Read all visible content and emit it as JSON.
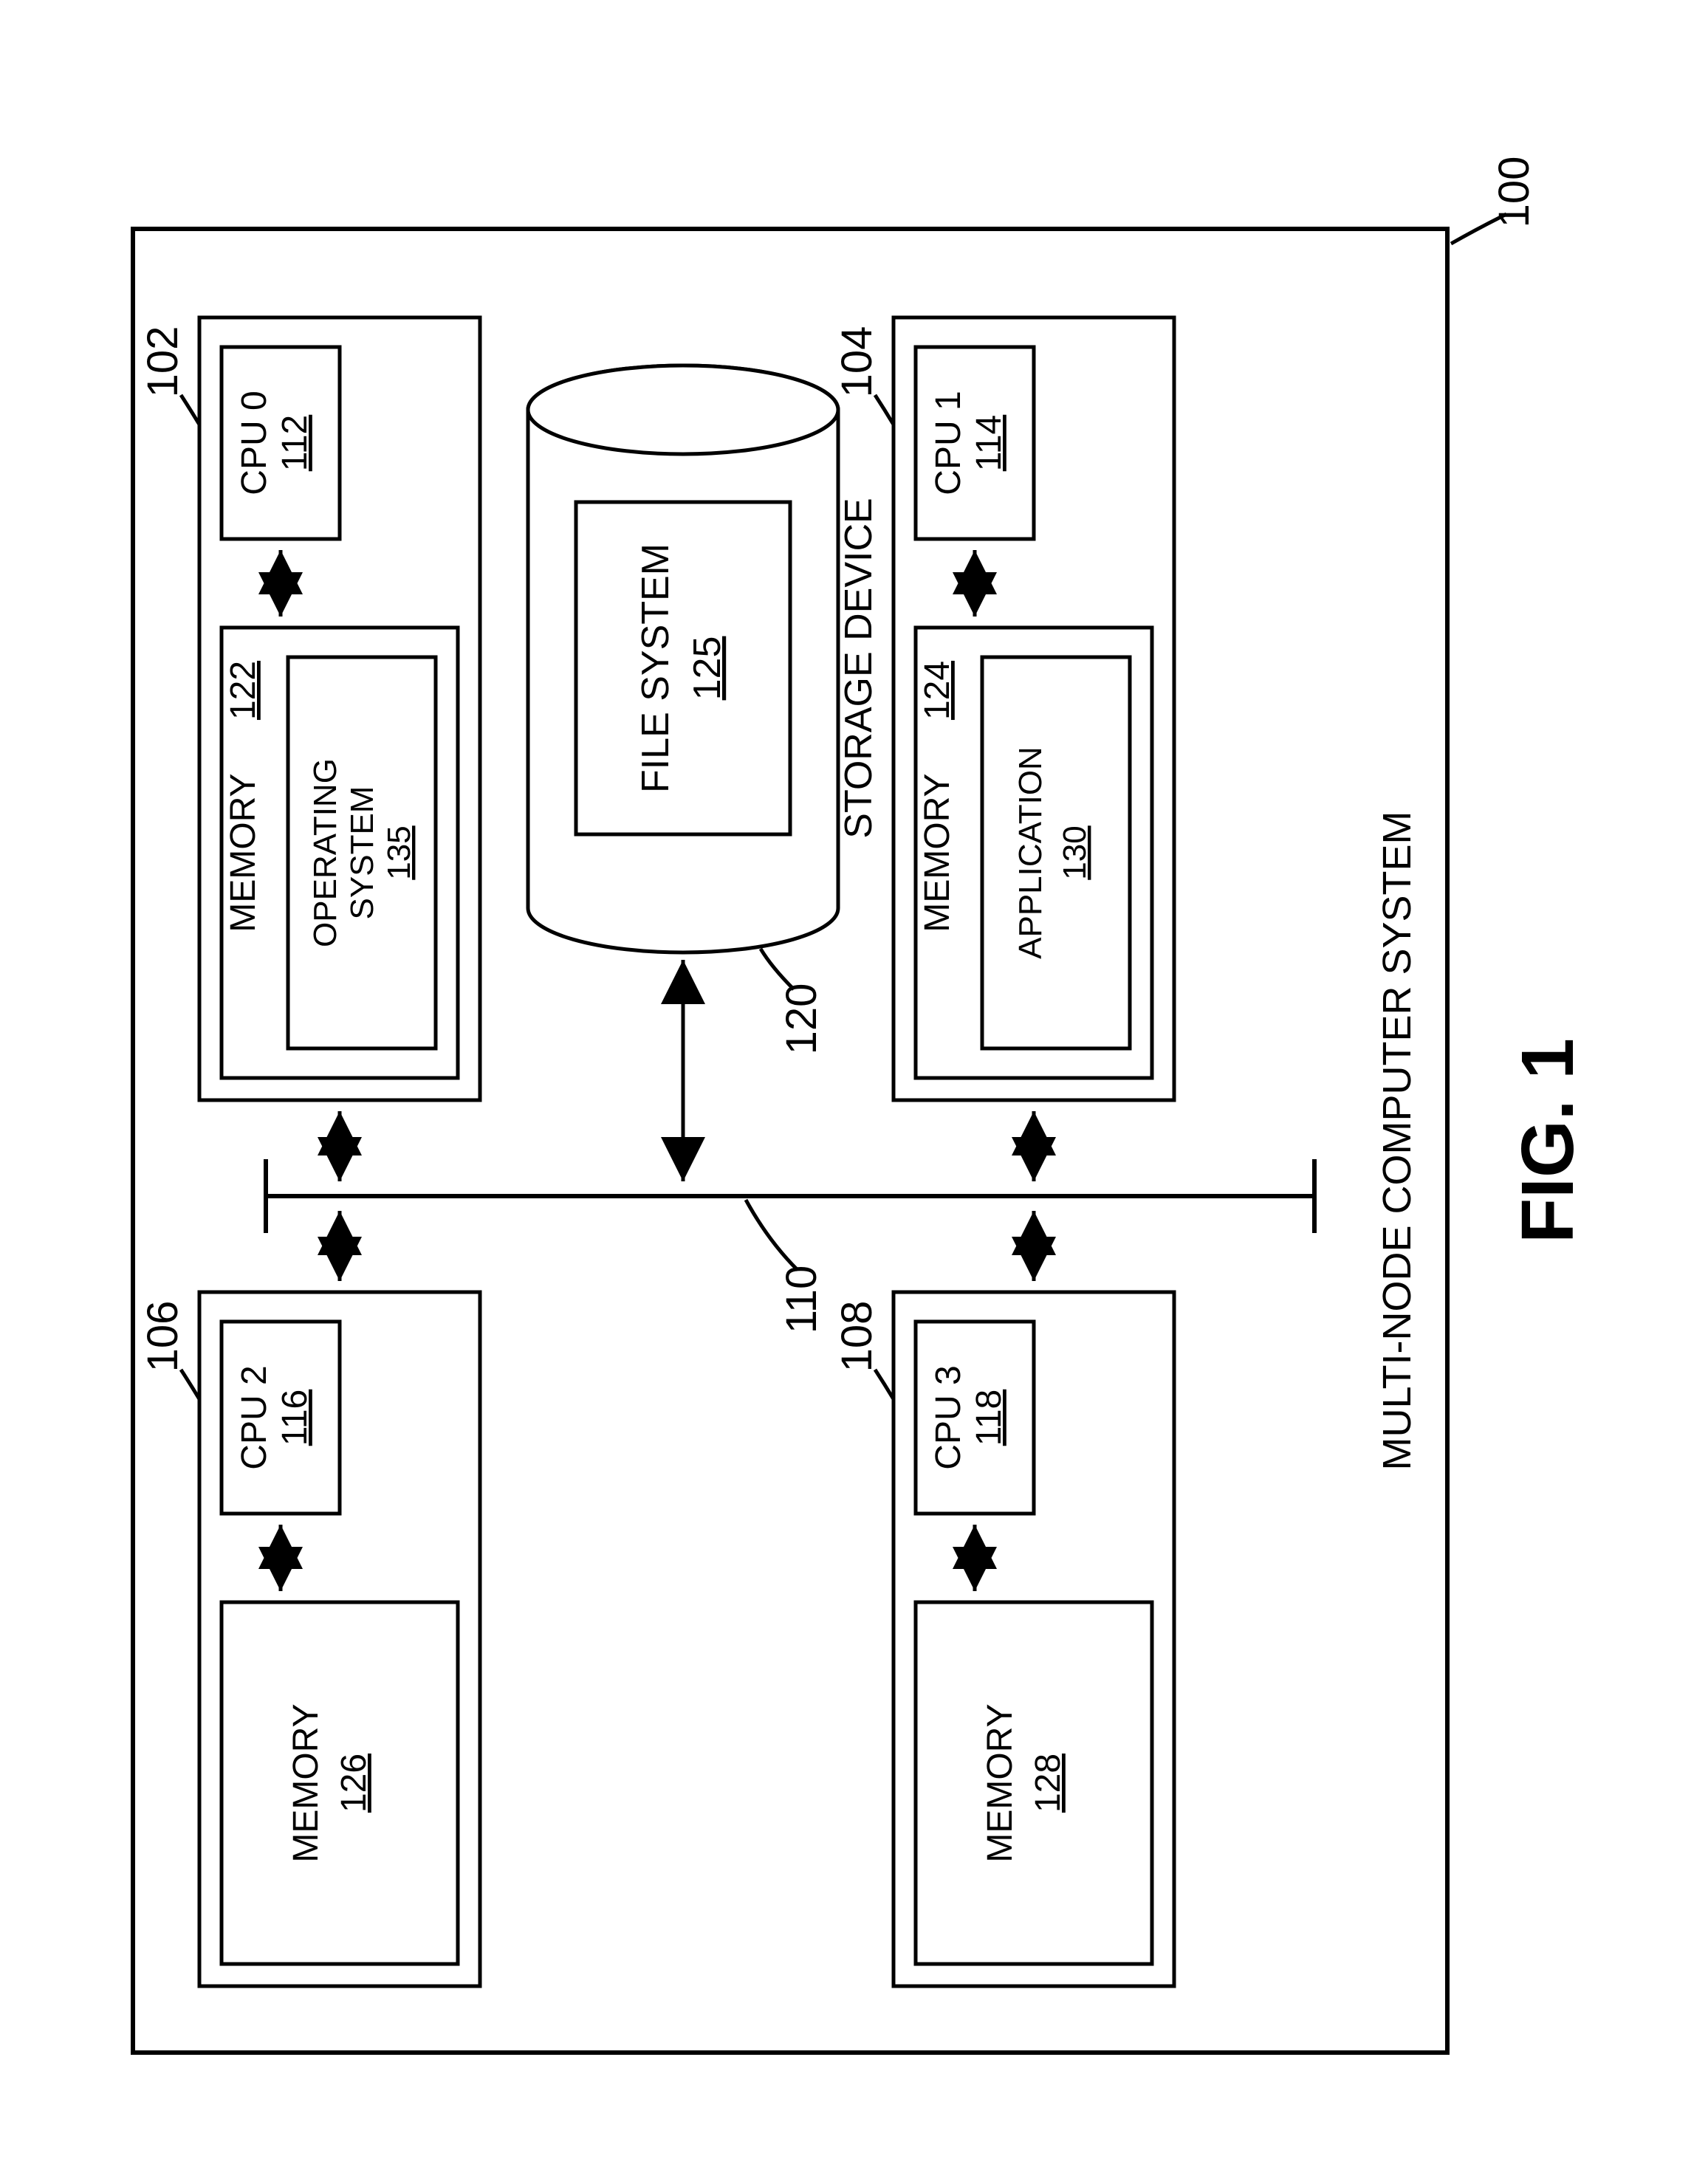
{
  "figure_label": "FIG. 1",
  "system_label": "MULTI-NODE COMPUTER SYSTEM",
  "ref_100": "100",
  "ref_110": "110",
  "ref_120": "120",
  "nodes": {
    "n102": {
      "ref": "102",
      "cpu_label": "CPU 0",
      "cpu_ref": "112",
      "mem_label": "MEMORY",
      "mem_ref": "122",
      "inner_label": "OPERATING\nSYSTEM",
      "inner_ref": "135"
    },
    "n104": {
      "ref": "104",
      "cpu_label": "CPU 1",
      "cpu_ref": "114",
      "mem_label": "MEMORY",
      "mem_ref": "124",
      "inner_label": "APPLICATION",
      "inner_ref": "130"
    },
    "n106": {
      "ref": "106",
      "cpu_label": "CPU 2",
      "cpu_ref": "116",
      "mem_label": "MEMORY",
      "mem_ref": "126"
    },
    "n108": {
      "ref": "108",
      "cpu_label": "CPU 3",
      "cpu_ref": "118",
      "mem_label": "MEMORY",
      "mem_ref": "128"
    }
  },
  "storage": {
    "label": "STORAGE DEVICE",
    "file_system_label": "FILE\nSYSTEM",
    "file_system_ref": "125"
  }
}
